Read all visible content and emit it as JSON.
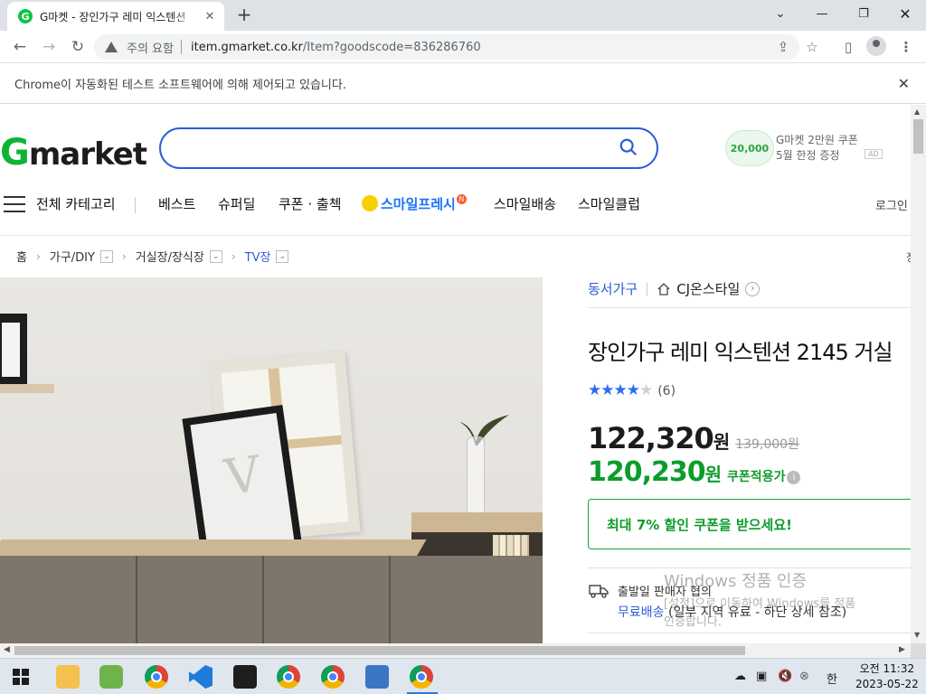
{
  "browser": {
    "tab_title": "G마켓 - 장인가구 레미 익스텐션",
    "tab_favicon": "G",
    "security_label": "주의 요함",
    "url_host": "item.gmarket.co.kr",
    "url_path": "/Item?goodscode=836286760",
    "infobar_message": "Chrome이 자동화된 테스트 소프트웨어에 의해 제어되고 있습니다."
  },
  "header": {
    "logo_g": "G",
    "logo_rest": "market",
    "search_placeholder": "",
    "ad_coupon_amount": "20,000",
    "ad_line1": "G마켓 2만원 쿠폰",
    "ad_line2": "5월 한정 증정",
    "ad_badge": "AD"
  },
  "nav": {
    "all_categories": "전체 카테고리",
    "items": [
      "베스트",
      "슈퍼딜",
      "쿠폰 · 출첵",
      "스마일프레시",
      "스마일배송",
      "스마일클럽"
    ],
    "new_badge": "N",
    "login": "로그인"
  },
  "breadcrumb": {
    "home": "홈",
    "level1": "가구/DIY",
    "level2": "거실장/장식장",
    "level3": "TV장",
    "end_char": "장"
  },
  "product": {
    "brand": "동서가구",
    "shop": "CJ온스타일",
    "title": "장인가구 레미 익스텐션 2145 거실",
    "rating": 4,
    "rating_max": 5,
    "review_count": "(6)",
    "price": "122,320",
    "price_unit": "원",
    "original_price": "139,000원",
    "coupon_price": "120,230",
    "coupon_label": "쿠폰적용가",
    "coupon_banner": "최대 7% 할인 쿠폰을 받으세요!",
    "shipping_origin": "출발일 판매자 협의",
    "shipping_free": "무료배송",
    "shipping_note": "(일부 지역 유료 - 하단 상세 참조)"
  },
  "watermark": {
    "line1": "Windows 정품 인증",
    "line2": "[설정]으로 이동하여 Windows를 정품",
    "line3": "인증합니다."
  },
  "taskbar": {
    "ime": "한",
    "time": "오전 11:32",
    "date": "2023-05-22"
  },
  "colors": {
    "accent_blue": "#2e5cd7",
    "gmarket_green": "#0cb436",
    "coupon_green": "#0c9c2c",
    "star_blue": "#2e6cf6"
  }
}
